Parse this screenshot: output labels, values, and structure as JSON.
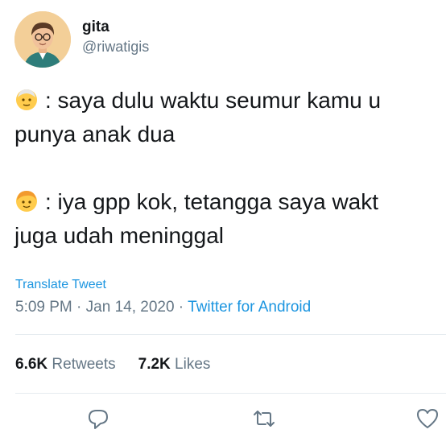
{
  "author": {
    "display_name": "gita",
    "handle": "@riwatigis",
    "avatar_icon": "illustrated-person-avatar"
  },
  "tweet": {
    "lines": [
      {
        "emoji_icon": "old-person-emoji",
        "text": ": saya dulu waktu seumur kamu u",
        "continuation": "punya anak dua"
      },
      {
        "emoji_icon": "child-emoji",
        "text": ": iya gpp kok, tetangga saya wakt",
        "continuation": "juga udah meninggal"
      }
    ]
  },
  "translate_label": "Translate Tweet",
  "meta": {
    "time": "5:09 PM",
    "separator": " · ",
    "date": "Jan 14, 2020",
    "separator2": " · ",
    "source": "Twitter for Android"
  },
  "stats": {
    "retweets_count": "6.6K",
    "retweets_label": "Retweets",
    "likes_count": "7.2K",
    "likes_label": "Likes"
  },
  "actions": {
    "icons": [
      "reply-icon",
      "retweet-icon",
      "like-icon"
    ]
  },
  "colors": {
    "link": "#1b95e0",
    "secondary_text": "#657786",
    "divider": "#e6ecf0"
  }
}
